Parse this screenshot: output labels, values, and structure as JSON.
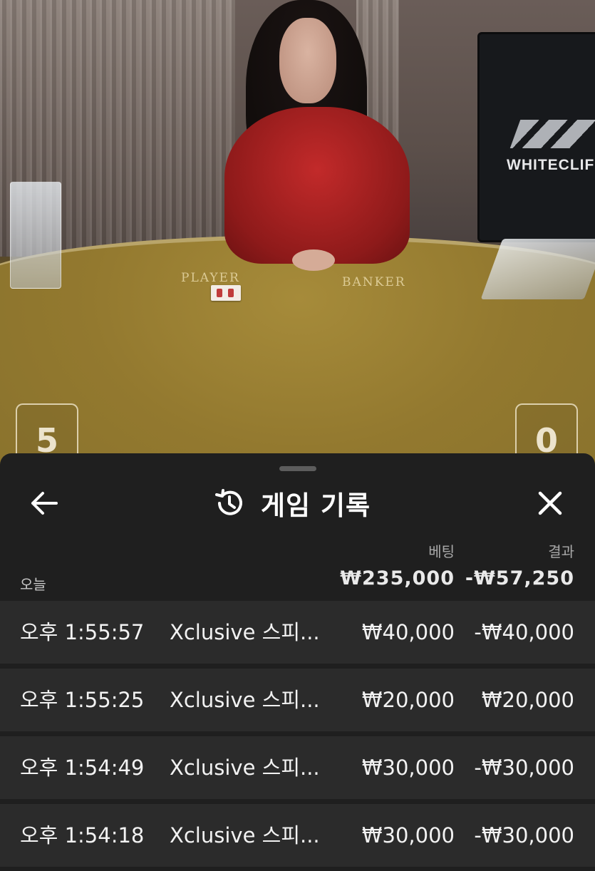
{
  "video": {
    "table_labels": {
      "player": "PLAYER",
      "banker": "BANKER"
    },
    "score_player": "5",
    "score_banker": "0",
    "logo": "WHITECLIFF"
  },
  "history": {
    "title": "게임 기록",
    "back_icon": "arrow-left-icon",
    "history_icon": "history-clock-icon",
    "close_icon": "close-icon",
    "column_bet": "베팅",
    "column_result": "결과",
    "period_label": "오늘",
    "total_bet": "₩235,000",
    "total_result": "-₩57,250",
    "rows": [
      {
        "time": "오후 1:55:57",
        "game": "Xclusive 스피...",
        "bet": "₩40,000",
        "result": "-₩40,000"
      },
      {
        "time": "오후 1:55:25",
        "game": "Xclusive 스피...",
        "bet": "₩20,000",
        "result": "₩20,000"
      },
      {
        "time": "오후 1:54:49",
        "game": "Xclusive 스피...",
        "bet": "₩30,000",
        "result": "-₩30,000"
      },
      {
        "time": "오후 1:54:18",
        "game": "Xclusive 스피...",
        "bet": "₩30,000",
        "result": "-₩30,000"
      }
    ]
  },
  "colors": {
    "sheet_bg": "#1f1f1f",
    "row_bg": "#2b2b2b",
    "felt": "#93792f",
    "muted_text": "#a9a9a9"
  }
}
